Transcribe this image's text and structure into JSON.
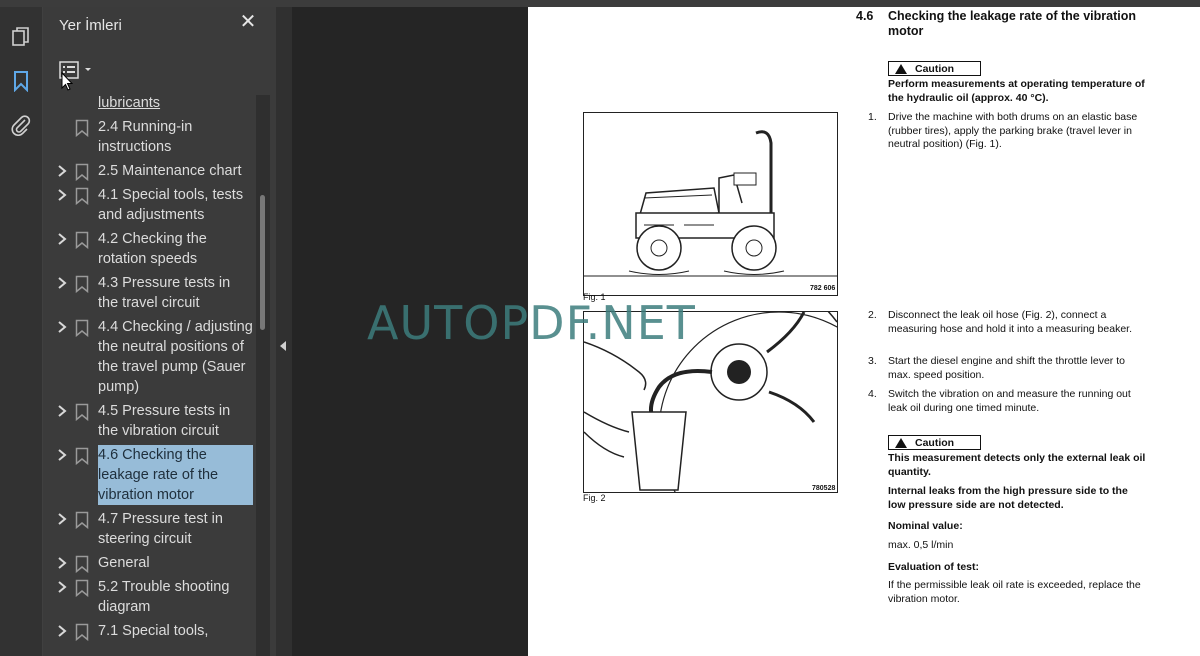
{
  "panel": {
    "title": "Yer İmleri",
    "close_symbol": "✕"
  },
  "icons": {
    "pages": "pages-icon",
    "bookmarks": "bookmark-icon",
    "attachments": "paperclip-icon"
  },
  "bookmarks": [
    {
      "label": "lubricants",
      "has_children": false,
      "selected": false
    },
    {
      "label": "2.4 Running-in instructions",
      "has_children": false,
      "selected": false
    },
    {
      "label": "2.5 Maintenance chart",
      "has_children": true,
      "selected": false
    },
    {
      "label": "4.1 Special tools, tests and adjustments",
      "has_children": true,
      "selected": false
    },
    {
      "label": "4.2 Checking the rotation speeds",
      "has_children": true,
      "selected": false
    },
    {
      "label": "4.3 Pressure tests in the travel circuit",
      "has_children": true,
      "selected": false
    },
    {
      "label": "4.4 Checking / adjusting the neutral positions of the travel pump (Sauer pump)",
      "has_children": true,
      "selected": false
    },
    {
      "label": "4.5 Pressure tests in the vibration circuit",
      "has_children": true,
      "selected": false
    },
    {
      "label": "4.6 Checking the leakage rate of the vibration motor",
      "has_children": true,
      "selected": true
    },
    {
      "label": "4.7 Pressure test in steering circuit",
      "has_children": true,
      "selected": false
    },
    {
      "label": "General",
      "has_children": true,
      "selected": false
    },
    {
      "label": "5.2 Trouble shooting diagram",
      "has_children": true,
      "selected": false
    },
    {
      "label": "7.1 Special tools,",
      "has_children": true,
      "selected": false
    }
  ],
  "document": {
    "section_number": "4.6",
    "section_title": "Checking the leakage rate of the vibration motor",
    "caution_label_1": "Caution",
    "caution_text_1": "Perform measurements at operating temperature of the hydraulic oil (approx. 40 °C).",
    "step1": "Drive the machine with both drums on an elastic base (rubber tires), apply the parking brake (travel lever in neutral position) (Fig. 1).",
    "fig1_caption": "Fig. 1",
    "fig1_code": "782 606",
    "fig2_caption": "Fig. 2",
    "fig2_code": "780528",
    "step2": "Disconnect the leak oil hose (Fig. 2), connect a measuring hose and hold it into a measuring beaker.",
    "step3": "Start the diesel engine and shift the throttle lever to max. speed position.",
    "step4": "Switch the vibration on and measure the running out leak oil during one timed minute.",
    "caution_label_2": "Caution",
    "caution_text_2a": "This measurement detects only the external leak oil quantity.",
    "caution_text_2b": "Internal leaks from the high pressure side to the low pressure side are not detected.",
    "nominal_label": "Nominal value:",
    "nominal_value": "max. 0,5 l/min",
    "evaluation_label": "Evaluation of test:",
    "evaluation_text": "If the permissible leak oil rate is exceeded, replace the vibration motor.",
    "n1": "1.",
    "n2": "2.",
    "n3": "3.",
    "n4": "4."
  },
  "watermark": "AUTOPDF.NET"
}
